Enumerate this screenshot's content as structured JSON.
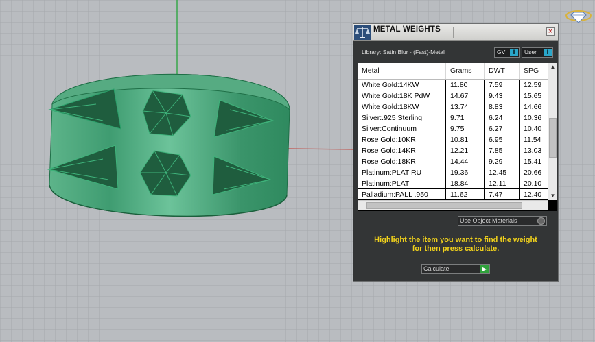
{
  "panel": {
    "title": "METAL WEIGHTS",
    "close_glyph": "×",
    "library_label": "Library: Satin Blur - (Fast)-Metal",
    "toggles": [
      {
        "label": "GV",
        "button": "I"
      },
      {
        "label": "User",
        "button": "I"
      }
    ],
    "table": {
      "columns": [
        "Metal",
        "Grams",
        "DWT",
        "SPG"
      ],
      "rows": [
        [
          "White Gold:14KW",
          "11.80",
          "7.59",
          "12.59"
        ],
        [
          "White Gold:18K PdW",
          "14.67",
          "9.43",
          "15.65"
        ],
        [
          "White Gold:18KW",
          "13.74",
          "8.83",
          "14.66"
        ],
        [
          "Silver:.925 Sterling",
          "9.71",
          "6.24",
          "10.36"
        ],
        [
          "Silver:Continuum",
          "9.75",
          "6.27",
          "10.40"
        ],
        [
          "Rose Gold:10KR",
          "10.81",
          "6.95",
          "11.54"
        ],
        [
          "Rose Gold:14KR",
          "12.21",
          "7.85",
          "13.03"
        ],
        [
          "Rose Gold:18KR",
          "14.44",
          "9.29",
          "15.41"
        ],
        [
          "Platinum:PLAT RU",
          "19.36",
          "12.45",
          "20.66"
        ],
        [
          "Platinum:PLAT",
          "18.84",
          "12.11",
          "20.10"
        ],
        [
          "Palladium:PALL .950",
          "11.62",
          "7.47",
          "12.40"
        ]
      ]
    },
    "use_object_materials": "Use Object Materials",
    "instructions_line1": "Highlight the item you want to find the weight",
    "instructions_line2": "for then press calculate.",
    "calculate_label": "Calculate",
    "calculate_glyph": "▶"
  },
  "icons": {
    "panel_icon": "scale-icon",
    "logo": "diamond-logo-icon"
  },
  "colors": {
    "grid_background": "#b9bcc0",
    "ring_green": "#3e9a70",
    "panel_background": "#333536",
    "instruction_text": "#f2d21b",
    "toggle_button": "#2aa6c9",
    "calculate_button": "#2fa13b"
  }
}
